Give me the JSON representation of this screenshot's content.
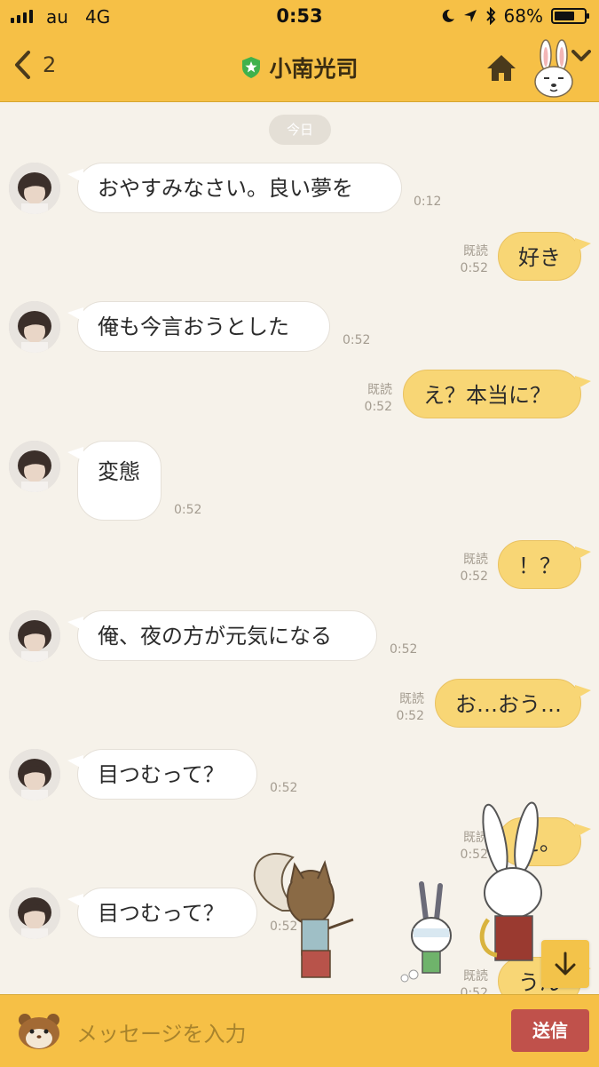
{
  "status_bar": {
    "carrier": "au",
    "network": "4G",
    "time": "0:53",
    "battery": "68%",
    "battery_level": 0.68
  },
  "header": {
    "back_count": "2",
    "contact_name": "小南光司"
  },
  "chat": {
    "date_divider": "今日",
    "messages": [
      {
        "direction": "in",
        "text": "おやすみなさい。良い夢を",
        "time": "0:12"
      },
      {
        "direction": "out",
        "text": "好き",
        "read": "既読",
        "time": "0:52"
      },
      {
        "direction": "in",
        "text": "俺も今言おうとした",
        "time": "0:52"
      },
      {
        "direction": "out",
        "text": "え？本当に？",
        "read": "既読",
        "time": "0:52"
      },
      {
        "direction": "in",
        "text": "変態",
        "time": "0:52"
      },
      {
        "direction": "out",
        "text": "！？",
        "read": "既読",
        "time": "0:52"
      },
      {
        "direction": "in",
        "text": "俺、夜の方が元気になる",
        "time": "0:52"
      },
      {
        "direction": "out",
        "text": "お…おう…",
        "read": "既読",
        "time": "0:52"
      },
      {
        "direction": "in",
        "text": "目つむって？",
        "time": "0:52"
      },
      {
        "direction": "out",
        "text": "え。",
        "read": "既読",
        "time": "0:52"
      },
      {
        "direction": "in",
        "text": "目つむって？",
        "time": "0:52"
      },
      {
        "direction": "out",
        "text": "うん",
        "read": "既読",
        "time": "0:52"
      }
    ]
  },
  "input_bar": {
    "placeholder": "メッセージを入力",
    "send_label": "送信"
  },
  "colors": {
    "header": "#f6c046",
    "outgoing_bubble": "#f8d675",
    "incoming_bubble": "#ffffff",
    "background": "#f6f2ea",
    "send_button": "#c0514b",
    "verified_badge": "#3fb14c"
  },
  "icons": [
    "signal-icon",
    "moon-icon",
    "location-icon",
    "bluetooth-icon",
    "battery-icon",
    "back-chevron-icon",
    "verified-badge-icon",
    "home-icon",
    "rabbit-avatar-icon",
    "chevron-down-icon",
    "scroll-down-arrow-icon",
    "hamster-icon"
  ]
}
